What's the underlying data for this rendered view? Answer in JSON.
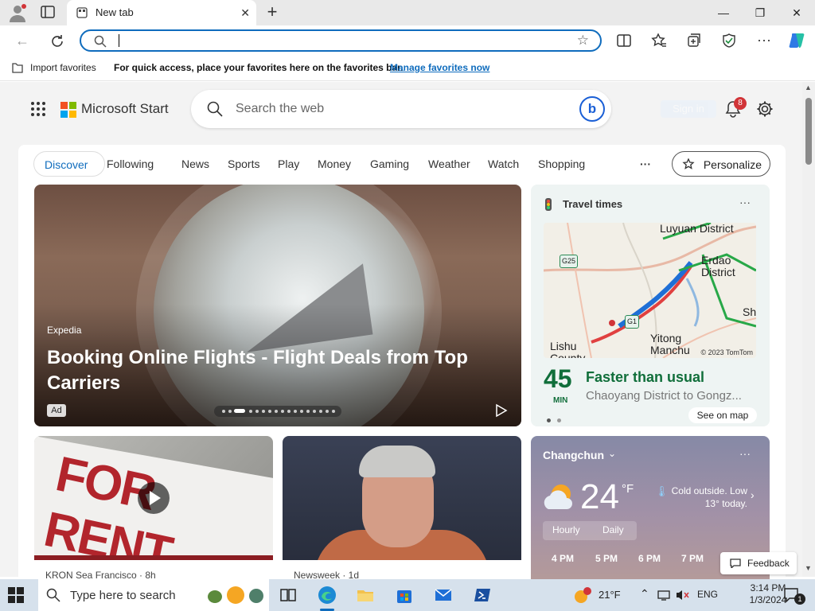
{
  "browser": {
    "tab": {
      "title": "New tab"
    },
    "address": {
      "value": ""
    },
    "favorites_bar": {
      "import_label": "Import favorites",
      "message": "For quick access, place your favorites here on the favorites bar.",
      "manage_link": "Manage favorites now"
    }
  },
  "ms_start": {
    "brand": "Microsoft Start",
    "search_placeholder": "Search the web",
    "bing_label": "b",
    "sign_in": "Sign in",
    "notification_count": "8",
    "nav": {
      "discover": "Discover",
      "following": "Following",
      "items": [
        "News",
        "Sports",
        "Play",
        "Money",
        "Gaming",
        "Weather",
        "Watch",
        "Shopping"
      ],
      "more": "···",
      "personalize": "Personalize"
    },
    "hero": {
      "source": "Expedia",
      "title": "Booking Online Flights - Flight Deals from Top Carriers",
      "ad_label": "Ad"
    },
    "travel": {
      "title": "Travel times",
      "more": "···",
      "map_labels": [
        "Luyuan District",
        "Erdao District",
        "Lishu County",
        "Yitong Manchu",
        "Sh"
      ],
      "road_labels": [
        "G25",
        "G1"
      ],
      "map_copyright": "© 2023 TomTom",
      "minutes": "45",
      "minutes_unit": "MIN",
      "status": "Faster than usual",
      "route": "Chaoyang District to Gongz...",
      "see_on_map": "See on map"
    },
    "cards": [
      {
        "caption": "KRON Sea Francisco · 8h"
      },
      {
        "caption": "Newsweek · 1d"
      }
    ],
    "weather": {
      "city": "Changchun",
      "more": "···",
      "temp": "24",
      "unit": "°F",
      "note": "Cold outside. Low 13° today.",
      "tab_hourly": "Hourly",
      "tab_daily": "Daily",
      "hours": [
        "4 PM",
        "5 PM",
        "6 PM",
        "7 PM"
      ]
    },
    "feedback": "Feedback"
  },
  "taskbar": {
    "search_placeholder": "Type here to search",
    "temperature": "21°F",
    "language": "ENG",
    "time": "3:14 PM",
    "date": "1/3/2024",
    "notifications": "1"
  },
  "colors": {
    "accent": "#0f6cbd",
    "travel_green": "#106e3a",
    "notification_red": "#d13438"
  }
}
